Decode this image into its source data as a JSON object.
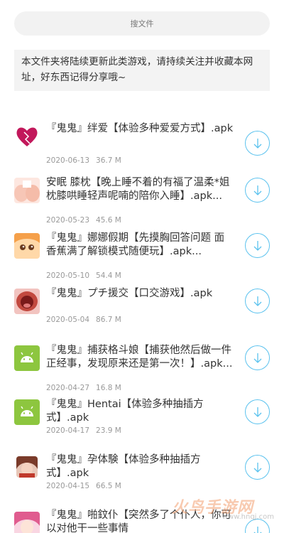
{
  "search": {
    "placeholder": "搜文件"
  },
  "notice": "本文件夹将陆续更新此类游戏，请持续关注并收藏本网址，好东西记得分享哦~",
  "files": [
    {
      "title": "『鬼鬼』绊爱【体验多种爱爱方式】.apk",
      "date": "2020-06-13",
      "size": "36.7 M",
      "icon": "heart-icon"
    },
    {
      "title": "安眠 膝枕【晚上睡不着的有福了温柔*姐枕膝哄睡轻声呢喃的陪你入睡】.apk...",
      "date": "2020-05-23",
      "size": "45.6 M",
      "icon": "pillow-icon"
    },
    {
      "title": "『鬼鬼』娜娜假期【先摸胸回答问题 面香蕉满了解锁模式随便玩】.apk...",
      "date": "2020-05-10",
      "size": "54.4 M",
      "icon": "anime-girl-icon"
    },
    {
      "title": "『鬼鬼』プチ援交【口交游戏】.apk",
      "date": "2020-05-04",
      "size": "86.7 M",
      "icon": "mouth-icon"
    },
    {
      "title": "『鬼鬼』捕获格斗娘【捕获他然后做一件正经事，发现原来还是第一次！】.apk...",
      "date": "2020-04-27",
      "size": "16.8 M",
      "icon": "android-icon"
    },
    {
      "title": "『鬼鬼』Hentai【体验多种抽插方式】.apk",
      "date": "2020-04-17",
      "size": "23.9 M",
      "icon": "android-icon"
    },
    {
      "title": "『鬼鬼』孕体験【体验多种抽插方式】.apk",
      "date": "2020-04-15",
      "size": "66.5 M",
      "icon": "girl-portrait-icon"
    },
    {
      "title": "『鬼鬼』啪鈫仆【突然多了个仆人，你可以对他干一些事情",
      "date": "",
      "size": "",
      "icon": "pink-hair-girl-icon"
    }
  ],
  "watermark": {
    "text": "火鸟手游网",
    "url": "www.hnqj.com"
  },
  "colors": {
    "accent": "#5bc2ee",
    "android": "#8dc63f"
  }
}
